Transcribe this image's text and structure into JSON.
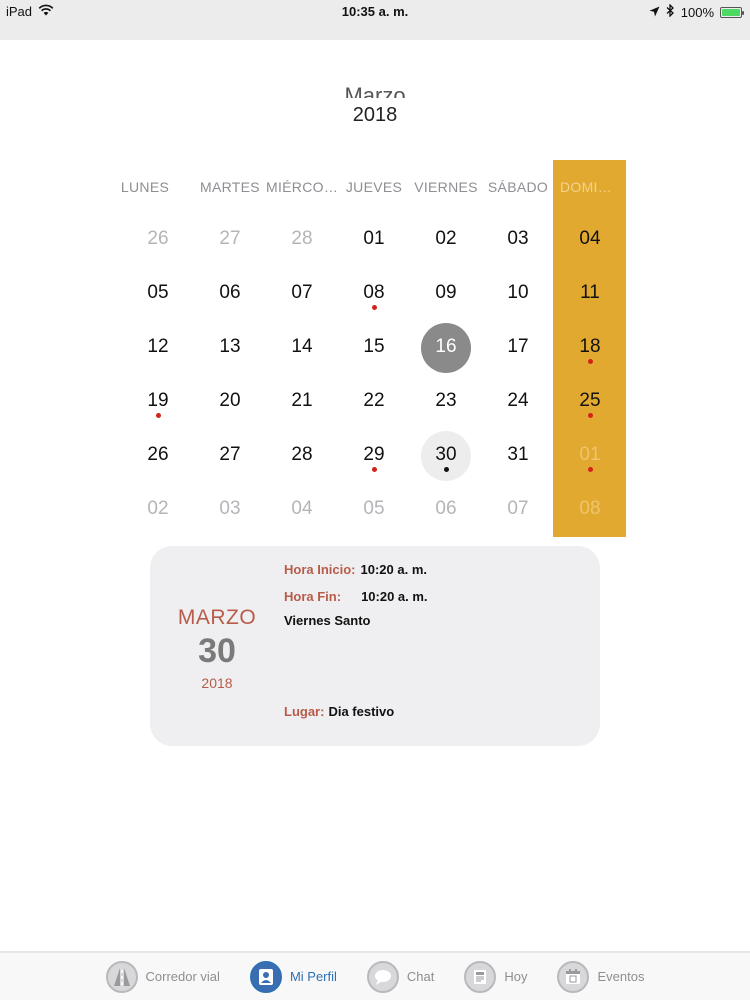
{
  "status_bar": {
    "device": "iPad",
    "time": "10:35 a. m.",
    "battery": "100%"
  },
  "calendar": {
    "month": "Marzo",
    "year": "2018",
    "weekdays": [
      "LUNES",
      "MARTES",
      "MIÉRCOLES",
      "JUEVES",
      "VIERNES",
      "SÁBADO",
      "DOMINGO"
    ],
    "weeks": [
      [
        {
          "d": "26",
          "o": true
        },
        {
          "d": "27",
          "o": true
        },
        {
          "d": "28",
          "o": true
        },
        {
          "d": "01"
        },
        {
          "d": "02"
        },
        {
          "d": "03"
        },
        {
          "d": "04"
        }
      ],
      [
        {
          "d": "05"
        },
        {
          "d": "06"
        },
        {
          "d": "07"
        },
        {
          "d": "08",
          "dot": "red"
        },
        {
          "d": "09"
        },
        {
          "d": "10"
        },
        {
          "d": "11"
        }
      ],
      [
        {
          "d": "12"
        },
        {
          "d": "13"
        },
        {
          "d": "14"
        },
        {
          "d": "15"
        },
        {
          "d": "16",
          "today": true
        },
        {
          "d": "17"
        },
        {
          "d": "18",
          "dot": "red"
        }
      ],
      [
        {
          "d": "19",
          "dot": "red"
        },
        {
          "d": "20"
        },
        {
          "d": "21"
        },
        {
          "d": "22"
        },
        {
          "d": "23"
        },
        {
          "d": "24"
        },
        {
          "d": "25",
          "dot": "red"
        }
      ],
      [
        {
          "d": "26"
        },
        {
          "d": "27"
        },
        {
          "d": "28"
        },
        {
          "d": "29",
          "dot": "red"
        },
        {
          "d": "30",
          "selected": true,
          "dot": "black"
        },
        {
          "d": "31"
        },
        {
          "d": "01",
          "o": true,
          "dot": "red"
        }
      ],
      [
        {
          "d": "02",
          "o": true
        },
        {
          "d": "03",
          "o": true
        },
        {
          "d": "04",
          "o": true
        },
        {
          "d": "05",
          "o": true
        },
        {
          "d": "06",
          "o": true
        },
        {
          "d": "07",
          "o": true
        },
        {
          "d": "08",
          "o": true
        }
      ]
    ],
    "colors": {
      "sunday_highlight": "#e1a92f",
      "today_circle": "#8a8a8a",
      "event_dot": "#d0241b"
    }
  },
  "event": {
    "month": "MARZO",
    "day": "30",
    "year": "2018",
    "start_label": "Hora Inicio:",
    "start_value": "10:20 a. m.",
    "end_label": "Hora Fin:",
    "end_value": "10:20 a. m.",
    "title": "Viernes Santo",
    "place_label": "Lugar:",
    "place_value": "Dia festivo"
  },
  "tabs": [
    {
      "label": "Corredor vial",
      "icon": "road-icon",
      "active": false
    },
    {
      "label": "Mi Perfil",
      "icon": "profile-icon",
      "active": true
    },
    {
      "label": "Chat",
      "icon": "chat-icon",
      "active": false
    },
    {
      "label": "Hoy",
      "icon": "newspaper-icon",
      "active": false
    },
    {
      "label": "Eventos",
      "icon": "calendar-icon",
      "active": false
    }
  ]
}
